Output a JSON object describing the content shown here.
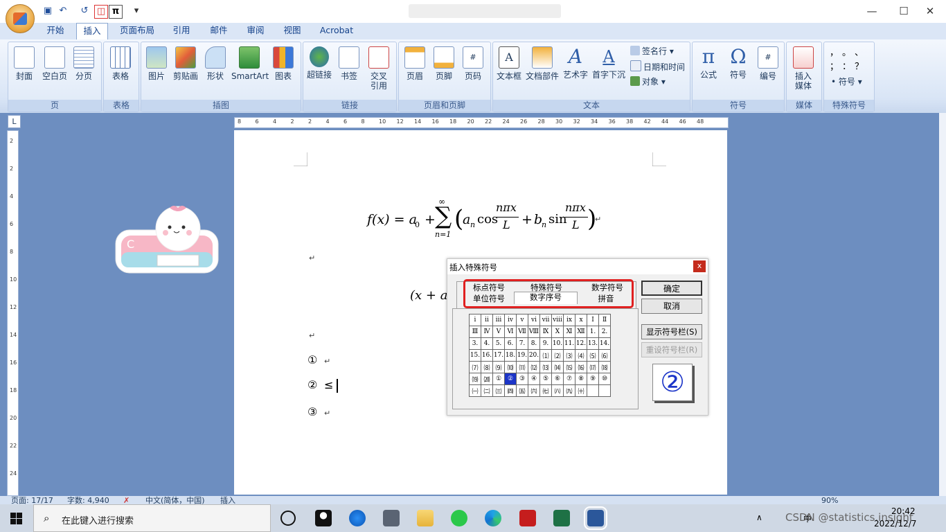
{
  "qat": {
    "pi_label": "π",
    "undo_glyph": "↶",
    "redo_glyph": "↺",
    "customize_glyph": "▾"
  },
  "window": {
    "minimize": "—",
    "maximize": "☐",
    "close": "✕"
  },
  "tabs": [
    "开始",
    "插入",
    "页面布局",
    "引用",
    "邮件",
    "审阅",
    "视图",
    "Acrobat"
  ],
  "active_tab": "插入",
  "ribbon": {
    "groups": [
      {
        "label": "页",
        "buttons": [
          "封面",
          "空白页",
          "分页"
        ]
      },
      {
        "label": "表格",
        "buttons": [
          "表格"
        ]
      },
      {
        "label": "插图",
        "buttons": [
          "图片",
          "剪贴画",
          "形状",
          "SmartArt",
          "图表"
        ]
      },
      {
        "label": "链接",
        "buttons": [
          "超链接",
          "书签",
          "交叉引用"
        ]
      },
      {
        "label": "页眉和页脚",
        "buttons": [
          "页眉",
          "页脚",
          "页码"
        ]
      },
      {
        "label": "文本",
        "buttons": [
          "文本框",
          "文档部件",
          "艺术字",
          "首字下沉"
        ],
        "small": [
          "签名行",
          "日期和时间",
          "对象"
        ]
      },
      {
        "label": "符号",
        "buttons": [
          "公式",
          "符号",
          "编号"
        ]
      },
      {
        "label": "媒体",
        "buttons": [
          "插入媒体"
        ]
      },
      {
        "label": "特殊符号",
        "symbols": [
          "，",
          "。",
          "、",
          "；",
          "：",
          "？"
        ],
        "small": "符号"
      }
    ]
  },
  "ruler": {
    "h_ticks": [
      "8",
      "6",
      "4",
      "2",
      "2",
      "4",
      "6",
      "8",
      "10",
      "12",
      "14",
      "16",
      "18",
      "20",
      "22",
      "24",
      "26",
      "28",
      "30",
      "32",
      "34",
      "36",
      "38",
      "42",
      "44",
      "46",
      "48"
    ],
    "v_ticks": [
      "2",
      "2",
      "4",
      "6",
      "8",
      "10",
      "12",
      "14",
      "16",
      "18",
      "20",
      "22",
      "24"
    ]
  },
  "doc": {
    "eq1": {
      "lhs": "f(x) = a",
      "sub0": "0",
      "plus": "+",
      "sum": "∑",
      "sup": "∞",
      "sub": "n=1",
      "an": "a",
      "n": "n",
      "cos": "cos",
      "frac_num": "nπx",
      "frac_den": "L",
      "plus2": "+",
      "bn": "b",
      "sin": "sin"
    },
    "eq2": "(x + a)",
    "list": [
      "①",
      "②",
      "③"
    ],
    "list2_extra": "≤"
  },
  "dialog": {
    "title": "插入特殊符号",
    "close": "x",
    "tabs_row1": [
      "标点符号",
      "特殊符号",
      "数学符号"
    ],
    "tabs_row2": [
      "单位符号",
      "数字序号",
      "拼音"
    ],
    "grid": [
      [
        "i",
        "ii",
        "iii",
        "iv",
        "v",
        "vi",
        "vii",
        "viii",
        "ix",
        "x",
        "Ⅰ",
        "Ⅱ"
      ],
      [
        "Ⅲ",
        "Ⅳ",
        "Ⅴ",
        "Ⅵ",
        "Ⅶ",
        "Ⅷ",
        "Ⅸ",
        "Ⅹ",
        "Ⅺ",
        "Ⅻ",
        "1.",
        "2."
      ],
      [
        "3.",
        "4.",
        "5.",
        "6.",
        "7.",
        "8.",
        "9.",
        "10.",
        "11.",
        "12.",
        "13.",
        "14."
      ],
      [
        "15.",
        "16.",
        "17.",
        "18.",
        "19.",
        "20.",
        "⑴",
        "⑵",
        "⑶",
        "⑷",
        "⑸",
        "⑹"
      ],
      [
        "⑺",
        "⑻",
        "⑼",
        "⑽",
        "⑾",
        "⑿",
        "⒀",
        "⒁",
        "⒂",
        "⒃",
        "⒄",
        "⒅"
      ],
      [
        "⒆",
        "⒇",
        "①",
        "②",
        "③",
        "④",
        "⑤",
        "⑥",
        "⑦",
        "⑧",
        "⑨",
        "⑩"
      ],
      [
        "㈠",
        "㈡",
        "㈢",
        "㈣",
        "㈤",
        "㈥",
        "㈦",
        "㈧",
        "㈨",
        "㈩",
        "",
        ""
      ]
    ],
    "selected": "②",
    "buttons": {
      "ok": "确定",
      "cancel": "取消",
      "show_bar": "显示符号栏(S)",
      "reset_bar": "重设符号栏(R)"
    },
    "preview": "②"
  },
  "status": {
    "page": "页面: 17/17",
    "words": "字数: 4,940",
    "lang": "中文(简体，中国)",
    "mode": "插入",
    "zoom": "90%"
  },
  "taskbar": {
    "search_placeholder": "在此键入进行搜索",
    "time": "20:42",
    "date": "2022/12/7",
    "ime": "中",
    "watermark": "CSDN @statistics.insight"
  }
}
